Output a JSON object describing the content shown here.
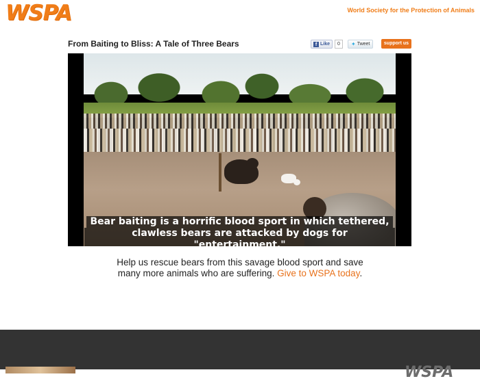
{
  "header": {
    "logo_text": "WSPA",
    "org_name": "World Society for the Protection of Animals"
  },
  "page": {
    "title": "From Baiting to Bliss: A Tale of Three Bears"
  },
  "social": {
    "like_label": "Like",
    "like_count": "0",
    "tweet_label": "Tweet",
    "support_label": "support us"
  },
  "video": {
    "caption_line1": "Bear baiting is a horrific blood sport in which tethered,",
    "caption_line2": "clawless bears are attacked by dogs for \"entertainment.\""
  },
  "message": {
    "text_line1": "Help us rescue bears from this savage blood sport and save",
    "text_line2": "many more animals who are suffering.",
    "link_text": "Give to WSPA today",
    "link_suffix": "."
  },
  "footer": {
    "logo_text": "WSPA"
  },
  "colors": {
    "accent": "#e8721c",
    "footer_bg": "#333333"
  }
}
